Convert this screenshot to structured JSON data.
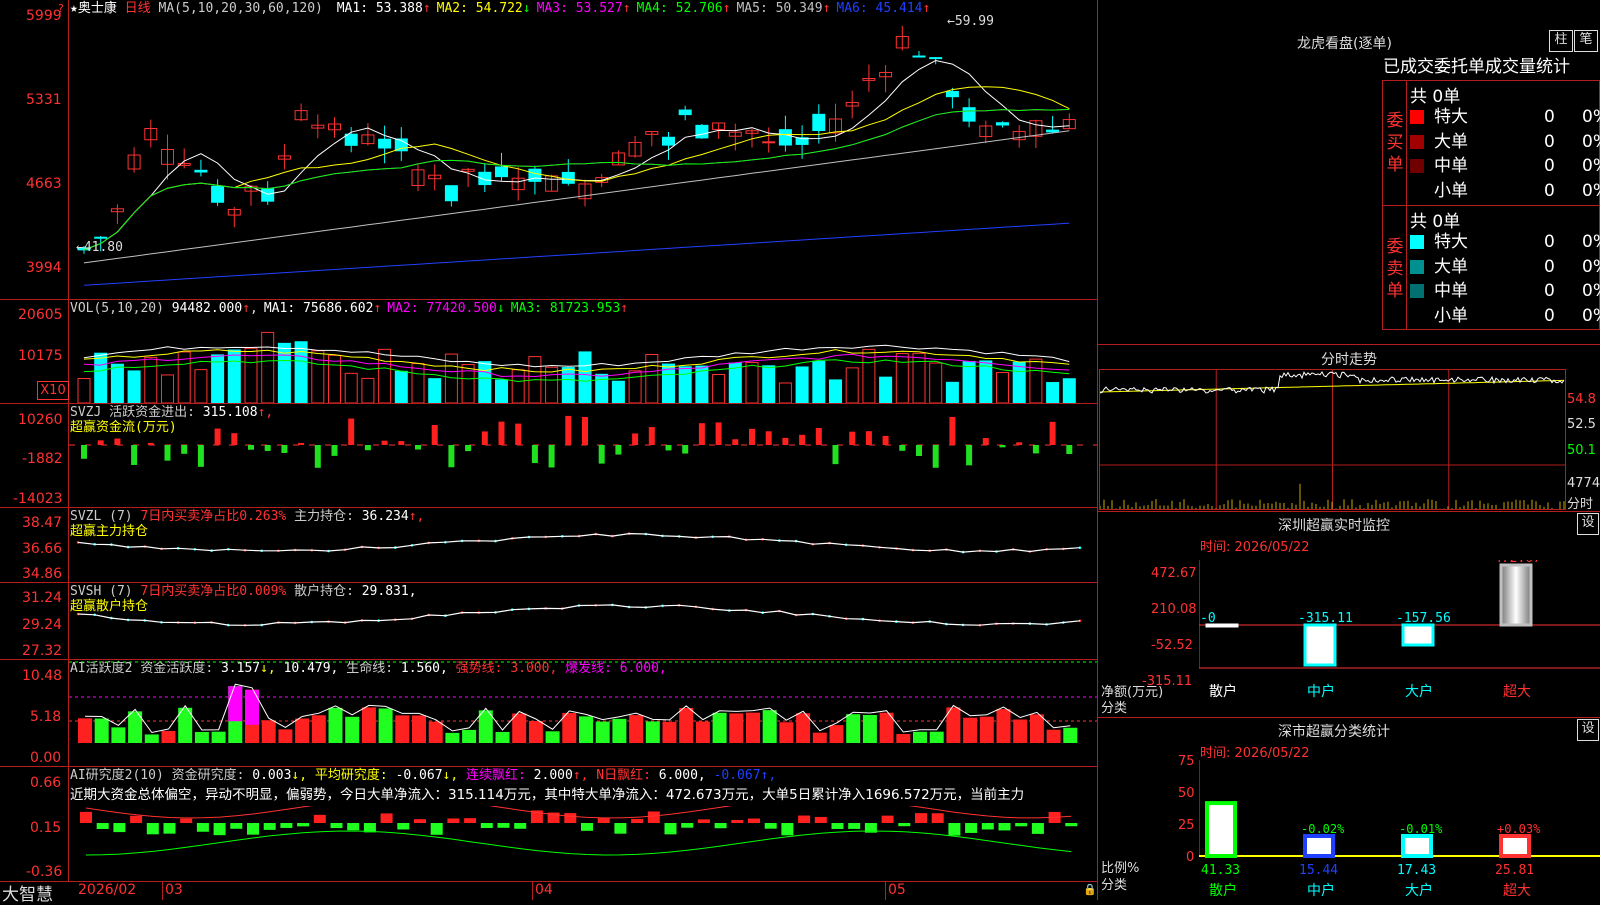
{
  "stock": {
    "name": "奥士康",
    "period": "日线",
    "ma_title": "MA(5,10,20,30,60,120)",
    "ma": [
      {
        "label": "MA1:",
        "value": "53.388",
        "arrow": "↑",
        "color": "#ffffff"
      },
      {
        "label": "MA2:",
        "value": "54.722",
        "arrow": "↓",
        "color": "#ffff00"
      },
      {
        "label": "MA3:",
        "value": "53.527",
        "arrow": "↑",
        "color": "#ff00ff"
      },
      {
        "label": "MA4:",
        "value": "52.706",
        "arrow": "↑",
        "color": "#00ff00"
      },
      {
        "label": "MA5:",
        "value": "50.349",
        "arrow": "↑",
        "color": "#c0c0c0"
      },
      {
        "label": "MA6:",
        "value": "45.414",
        "arrow": "↑",
        "color": "#2040ff"
      }
    ],
    "price_axis": [
      "5999",
      "5331",
      "4663",
      "3994"
    ],
    "high_mark": "59.99",
    "low_mark": "41.80"
  },
  "vol": {
    "title": "VOL(5,10,20)",
    "value": "94482.000",
    "arrow": "↑",
    "ma": [
      {
        "label": "MA1:",
        "value": "75686.602",
        "arrow": "↑",
        "color": "#ffffff"
      },
      {
        "label": "MA2:",
        "value": "77420.500",
        "arrow": "↓",
        "color": "#ff00ff"
      },
      {
        "label": "MA3:",
        "value": "81723.953",
        "arrow": "↑",
        "color": "#00ff00"
      }
    ],
    "axis": [
      "20605",
      "10175"
    ],
    "unit": "X10"
  },
  "svzj": {
    "title": "SVZJ",
    "label": "活跃资金进出:",
    "value": "315.108",
    "arrow": "↑,",
    "subtitle": "超赢资金流(万元)",
    "axis": [
      "10260",
      "-1882",
      "-14023"
    ]
  },
  "svzl": {
    "title": "SVZL",
    "param": "(7)",
    "label1": "7日内买卖净占比0.263%",
    "label2": "主力持仓:",
    "value": "36.234",
    "arrow": "↑,",
    "subtitle": "超赢主力持仓",
    "axis": [
      "38.47",
      "36.66",
      "34.86"
    ]
  },
  "svsh": {
    "title": "SVSH",
    "param": "(7)",
    "label1": "7日内买卖净占比0.009%",
    "label2": "散户持仓:",
    "value": "29.831,",
    "subtitle": "超赢散户持仓",
    "axis": [
      "31.24",
      "29.24",
      "27.32"
    ]
  },
  "ai_active": {
    "title": "AI活跃度2",
    "label1": "资金活跃度:",
    "value1": "3.157",
    "arrow1": "↓,",
    "value2": "10.479,",
    "label3": "生命线:",
    "value3": "1.560,",
    "label4": "强势线:",
    "value4": "3.000,",
    "label5": "爆发线:",
    "value5": "6.000,",
    "axis": [
      "10.48",
      "5.18",
      "0.00"
    ]
  },
  "ai_research": {
    "title": "AI研究度2(10)",
    "label1": "资金研究度:",
    "value1": "0.003",
    "arrow1": "↓,",
    "label2": "平均研究度:",
    "value2": "-0.067",
    "arrow2": "↓,",
    "label3": "连续飘红:",
    "value3": "2.000",
    "arrow3": "↑,",
    "label4": "N日飘红:",
    "value4": "6.000,",
    "value5": "-0.067",
    "arrow5": "↑,",
    "summary": "近期大资金总体偏空，异动不明显，偏弱势，今日大单净流入：315.114万元，其中特大单净流入：472.673万元，大单5日累计净入1696.572万元，当前主力",
    "axis": [
      "0.66",
      "0.15",
      "-0.36"
    ]
  },
  "timeline": {
    "logo": "大智慧",
    "dates": [
      "2026/02",
      "03",
      "04",
      "05"
    ]
  },
  "dragon_tiger": {
    "title": "龙虎看盘(逐单)",
    "btn_bar": "柱",
    "btn_pen": "笔",
    "tabs": [
      "已成交",
      "委托单",
      "成交量统计"
    ],
    "buy_side": {
      "label": "委买单",
      "total": "共 0单",
      "rows": [
        {
          "name": "特大",
          "count": "0",
          "pct": "0%",
          "color": "#ff0000"
        },
        {
          "name": "大单",
          "count": "0",
          "pct": "0%",
          "color": "#a00000"
        },
        {
          "name": "中单",
          "count": "0",
          "pct": "0%",
          "color": "#700000"
        },
        {
          "name": "小单",
          "count": "0",
          "pct": "0%",
          "color": ""
        }
      ]
    },
    "sell_side": {
      "label": "委卖单",
      "total": "共 0单",
      "rows": [
        {
          "name": "特大",
          "count": "0",
          "pct": "0%",
          "color": "#00ffff"
        },
        {
          "name": "大单",
          "count": "0",
          "pct": "0%",
          "color": "#009090"
        },
        {
          "name": "中单",
          "count": "0",
          "pct": "0%",
          "color": "#007070"
        },
        {
          "name": "小单",
          "count": "0",
          "pct": "0%",
          "color": ""
        }
      ]
    }
  },
  "intraday": {
    "title": "分时走势",
    "axis": [
      "54.8",
      "52.5",
      "50.1"
    ],
    "vol_axis": "4774",
    "footer": "分时"
  },
  "sz_monitor": {
    "title": "深圳超赢实时监控",
    "btn": "设",
    "time_label": "时间:",
    "time": "2026/05/22",
    "axis": [
      "472.67",
      "210.08",
      "-52.52",
      "-315.11"
    ],
    "ylabel": "净额(万元)",
    "xlabel": "分类",
    "categories": [
      "散户",
      "中户",
      "大户",
      "超大"
    ],
    "values": [
      "-0",
      "-315.11",
      "-157.56",
      "472.67"
    ]
  },
  "sz_stats": {
    "title": "深市超赢分类统计",
    "btn": "设",
    "time_label": "时间:",
    "time": "2026/05/22",
    "axis": [
      "75",
      "50",
      "25",
      "0"
    ],
    "ylabel": "比例%",
    "xlabel": "分类",
    "categories": [
      "散户",
      "中户",
      "大户",
      "超大"
    ],
    "top_labels": [
      "",
      "-0.02%",
      "-0.01%",
      "+0.03%"
    ],
    "values": [
      "41.33",
      "15.44",
      "17.43",
      "25.81"
    ]
  },
  "chart_data": [
    {
      "type": "candlestick",
      "title": "奥士康 日线",
      "ylim": [
        39.94,
        59.99
      ],
      "high": 59.99,
      "low": 41.8
    },
    {
      "type": "bar",
      "title": "深圳超赢实时监控",
      "ylabel": "净额(万元)",
      "categories": [
        "散户",
        "中户",
        "大户",
        "超大"
      ],
      "values": [
        0,
        -315.11,
        -157.56,
        472.67
      ],
      "ylim": [
        -315.11,
        472.67
      ]
    },
    {
      "type": "bar",
      "title": "深市超赢分类统计",
      "ylabel": "比例%",
      "categories": [
        "散户",
        "中户",
        "大户",
        "超大"
      ],
      "values": [
        41.33,
        15.44,
        17.43,
        25.81
      ],
      "ylim": [
        0,
        75
      ]
    }
  ]
}
